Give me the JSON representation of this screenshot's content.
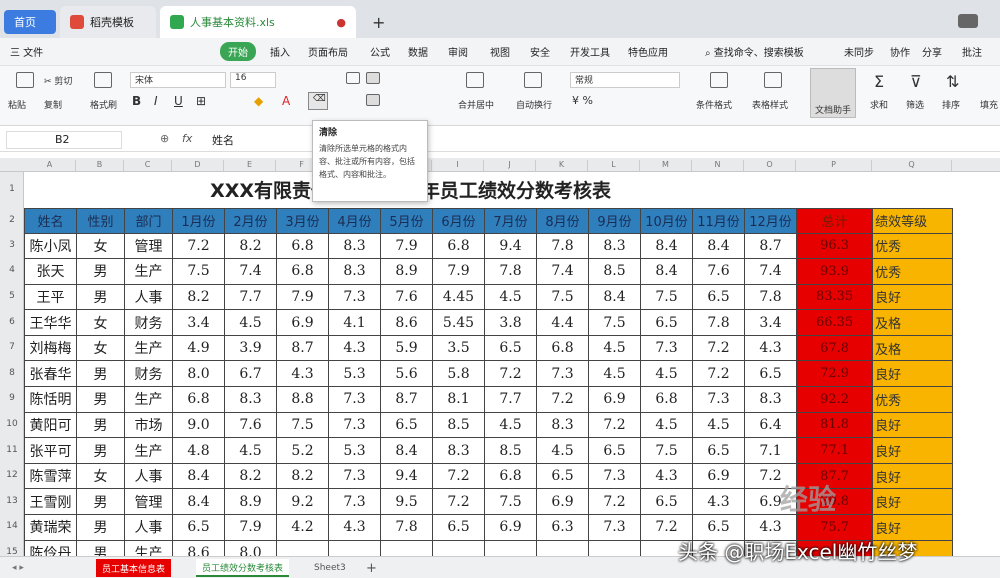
{
  "app": {
    "tabs": [
      {
        "label": "首页"
      },
      {
        "label": "稻壳模板"
      },
      {
        "label": "人事基本资料.xls"
      }
    ],
    "new_tab": "+"
  },
  "menu": {
    "file": "三 文件",
    "items": [
      "开始",
      "插入",
      "页面布局",
      "公式",
      "数据",
      "审阅",
      "视图",
      "安全",
      "开发工具",
      "特色应用"
    ],
    "search": "查找命令、搜索模板",
    "sync": "未同步",
    "collab": "协作",
    "share": "分享",
    "batch": "批注"
  },
  "ribbon": {
    "cut": "剪切",
    "paste": "粘贴",
    "copy": "复制",
    "format_painter": "格式刷",
    "font_name": "宋体",
    "font_size": "16",
    "merge": "合并居中",
    "wrap": "自动换行",
    "number_format": "常规",
    "cond_format": "条件格式",
    "table_style": "表格样式",
    "doc_helper": "文档助手",
    "sum": "求和",
    "filter": "筛选",
    "sort": "排序",
    "fill": "填充"
  },
  "formula_bar": {
    "cell_ref": "B2",
    "fx": "fx",
    "value": "姓名"
  },
  "tooltip": {
    "title": "清除",
    "body": "清除所选单元格的格式内容、批注或所有内容，包括格式、内容和批注。"
  },
  "columns": [
    "A",
    "B",
    "C",
    "D",
    "E",
    "F",
    "G",
    "H",
    "I",
    "J",
    "K",
    "L",
    "M",
    "N",
    "O",
    "P",
    "Q"
  ],
  "rows": [
    "1",
    "2",
    "3",
    "4",
    "5",
    "6",
    "7",
    "8",
    "9",
    "10",
    "11",
    "12",
    "13",
    "14",
    "15"
  ],
  "sheet": {
    "title": "XXX有限责任公司2021年员工绩效分数考核表",
    "headers": [
      "姓名",
      "性别",
      "部门",
      "1月份",
      "2月份",
      "3月份",
      "4月份",
      "5月份",
      "6月份",
      "7月份",
      "8月份",
      "9月份",
      "10月份",
      "11月份",
      "12月份",
      "总计",
      "绩效等级"
    ],
    "data": [
      [
        "陈小凤",
        "女",
        "管理",
        "7.2",
        "8.2",
        "6.8",
        "8.3",
        "7.9",
        "6.8",
        "9.4",
        "7.8",
        "8.3",
        "8.4",
        "8.4",
        "8.7",
        "96.3",
        "优秀"
      ],
      [
        "张天",
        "男",
        "生产",
        "7.5",
        "7.4",
        "6.8",
        "8.3",
        "8.9",
        "7.9",
        "7.8",
        "7.4",
        "8.5",
        "8.4",
        "7.6",
        "7.4",
        "93.9",
        "优秀"
      ],
      [
        "王平",
        "男",
        "人事",
        "8.2",
        "7.7",
        "7.9",
        "7.3",
        "7.6",
        "4.45",
        "4.5",
        "7.5",
        "8.4",
        "7.5",
        "6.5",
        "7.8",
        "83.35",
        "良好"
      ],
      [
        "王华华",
        "女",
        "财务",
        "3.4",
        "4.5",
        "6.9",
        "4.1",
        "8.6",
        "5.45",
        "3.8",
        "4.4",
        "7.5",
        "6.5",
        "7.8",
        "3.4",
        "66.35",
        "及格"
      ],
      [
        "刘梅梅",
        "女",
        "生产",
        "4.9",
        "3.9",
        "8.7",
        "4.3",
        "5.9",
        "3.5",
        "6.5",
        "6.8",
        "4.5",
        "7.3",
        "7.2",
        "4.3",
        "67.8",
        "及格"
      ],
      [
        "张春华",
        "男",
        "财务",
        "8.0",
        "6.7",
        "4.3",
        "5.3",
        "5.6",
        "5.8",
        "7.2",
        "7.3",
        "4.5",
        "4.5",
        "7.2",
        "6.5",
        "72.9",
        "良好"
      ],
      [
        "陈恬明",
        "男",
        "生产",
        "6.8",
        "8.3",
        "8.8",
        "7.3",
        "8.7",
        "8.1",
        "7.7",
        "7.2",
        "6.9",
        "6.8",
        "7.3",
        "8.3",
        "92.2",
        "优秀"
      ],
      [
        "黄阳可",
        "男",
        "市场",
        "9.0",
        "7.6",
        "7.5",
        "7.3",
        "6.5",
        "8.5",
        "4.5",
        "8.3",
        "7.2",
        "4.5",
        "4.5",
        "6.4",
        "81.8",
        "良好"
      ],
      [
        "张平可",
        "男",
        "生产",
        "4.8",
        "4.5",
        "5.2",
        "5.3",
        "8.4",
        "8.3",
        "8.5",
        "4.5",
        "6.5",
        "7.5",
        "6.5",
        "7.1",
        "77.1",
        "良好"
      ],
      [
        "陈雪萍",
        "女",
        "人事",
        "8.4",
        "8.2",
        "8.2",
        "7.3",
        "9.4",
        "7.2",
        "6.8",
        "6.5",
        "7.3",
        "4.3",
        "6.9",
        "7.2",
        "87.7",
        "良好"
      ],
      [
        "王雪刚",
        "男",
        "管理",
        "8.4",
        "8.9",
        "9.2",
        "7.3",
        "9.5",
        "7.2",
        "7.5",
        "6.9",
        "7.2",
        "6.5",
        "4.3",
        "6.9",
        "89.8",
        "良好"
      ],
      [
        "黄瑞荣",
        "男",
        "人事",
        "6.5",
        "7.9",
        "4.2",
        "4.3",
        "7.8",
        "6.5",
        "6.9",
        "6.3",
        "7.3",
        "7.2",
        "6.5",
        "4.3",
        "75.7",
        "良好"
      ],
      [
        "陈伶丹",
        "男",
        "生产",
        "8.6",
        "8.0",
        "",
        "",
        "",
        "",
        "",
        "",
        "",
        "",
        "",
        "",
        "",
        ""
      ]
    ]
  },
  "sheet_tabs": [
    "员工基本信息表",
    "员工绩效分数考核表",
    "Sheet3"
  ],
  "watermark": "头条 @职场Excel幽竹丝梦",
  "watermark2": "经验"
}
